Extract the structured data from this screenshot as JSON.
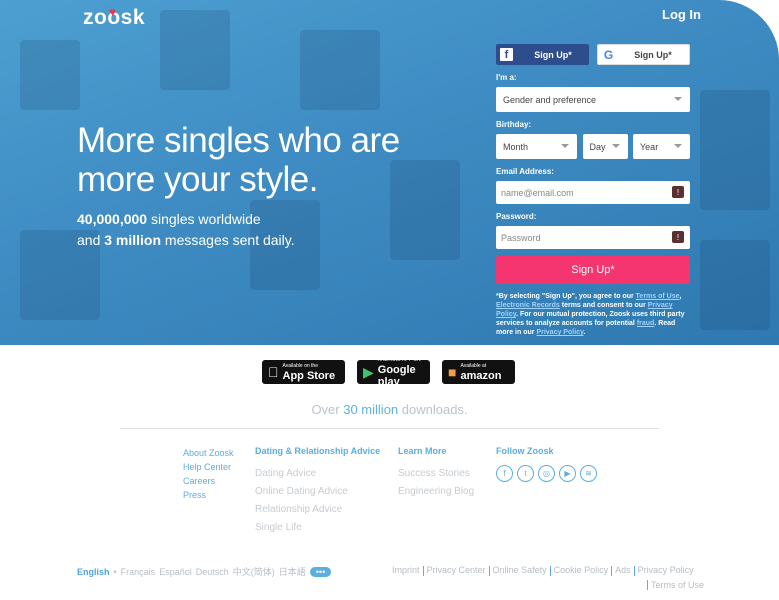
{
  "brand": {
    "logo": "zoosk"
  },
  "header": {
    "login_label": "Log In"
  },
  "hero": {
    "headline": "More singles who are more your style.",
    "stat1_bold": "40,000,000",
    "stat1_rest": " singles worldwide",
    "stat2_pre": "and ",
    "stat2_bold": "3 million",
    "stat2_rest": " messages sent daily."
  },
  "form": {
    "facebook_label": "Sign Up*",
    "google_label": "Sign Up*",
    "im_a_label": "I'm a:",
    "gender_value": "Gender and preference",
    "birthday_label": "Birthday:",
    "month_value": "Month",
    "day_value": "Day",
    "year_value": "Year",
    "email_label": "Email Address:",
    "email_placeholder": "name@email.com",
    "password_label": "Password:",
    "password_placeholder": "Password",
    "signup_label": "Sign Up*",
    "legal": {
      "p1": "*By selecting \"Sign Up\", you agree to our ",
      "terms": "Terms of Use",
      "p2": ", ",
      "records": "Electronic Records",
      "p3": " terms and consent to our ",
      "privacy": "Privacy Policy",
      "p4": ". For our mutual protection, Zoosk uses third party services to analyze accounts for potential ",
      "fraud": "fraud",
      "p5": ". Read more in our ",
      "privacy2": "Privacy Policy",
      "p6": "."
    }
  },
  "stores": {
    "apple_small": "Available on the",
    "apple_big": "App Store",
    "google_small": "ANDROID APP ON",
    "google_big": "Google play",
    "amazon_small": "Available at",
    "amazon_big": "amazon"
  },
  "downloads": {
    "pre": "Over ",
    "bold": "30 million",
    "post": " downloads."
  },
  "footer": {
    "col1": [
      "About Zoosk",
      "Help Center",
      "Careers",
      "Press"
    ],
    "col2_head": "Dating & Relationship Advice",
    "col2": [
      "Dating Advice",
      "Online Dating Advice",
      "Relationship Advice",
      "Single Life"
    ],
    "col3_head": "Learn More",
    "col3": [
      "Success Stories",
      "Engineering Blog"
    ],
    "col4_head": "Follow Zoosk",
    "social_icons": [
      "facebook-icon",
      "twitter-icon",
      "instagram-icon",
      "youtube-icon",
      "rss-icon"
    ]
  },
  "languages": {
    "current": "English",
    "others": [
      "Français",
      "Español",
      "Deutsch",
      "中文(简体)",
      "日本語"
    ],
    "more": "•••"
  },
  "legal_links": [
    "Imprint",
    "Privacy Center",
    "Online Safety",
    "Cookie Policy",
    "Ads",
    "Privacy Policy",
    "Terms of Use"
  ],
  "colors": {
    "primary_blue": "#3f8dc4",
    "signup_pink": "#f4356f",
    "facebook": "#2d4d8c",
    "link_blue": "#5aaee0"
  }
}
